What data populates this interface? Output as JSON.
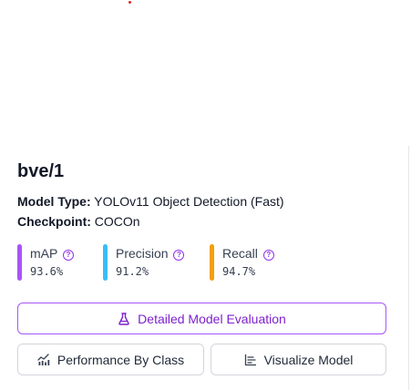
{
  "model": {
    "title": "bve/1",
    "model_type_label": "Model Type:",
    "model_type_value": "YOLOv11 Object Detection (Fast)",
    "checkpoint_label": "Checkpoint:",
    "checkpoint_value": "COCOn"
  },
  "metrics": [
    {
      "label": "mAP",
      "value": "93.6%",
      "color": "#a855f7"
    },
    {
      "label": "Precision",
      "value": "91.2%",
      "color": "#38bdf8"
    },
    {
      "label": "Recall",
      "value": "94.7%",
      "color": "#f59e0b"
    }
  ],
  "buttons": {
    "evaluation": {
      "label": "Detailed Model Evaluation",
      "icon": "flask-icon"
    },
    "performance": {
      "label": "Performance By Class",
      "icon": "chart-icon"
    },
    "visualize": {
      "label": "Visualize Model",
      "icon": "bar-chart-icon"
    }
  },
  "help_glyph": "?",
  "colors": {
    "accent": "#9333ea",
    "marker": "#dc2626"
  }
}
